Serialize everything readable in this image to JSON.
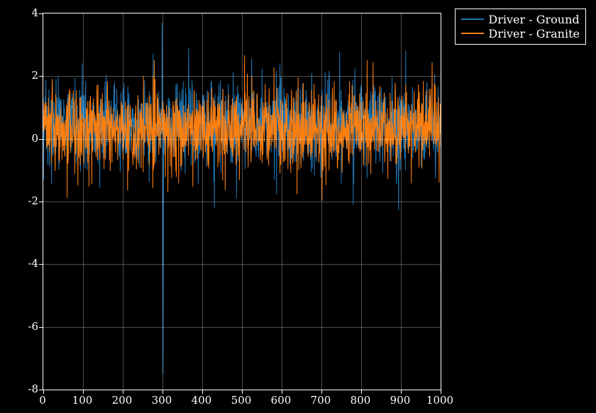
{
  "chart_data": {
    "type": "line",
    "title": "",
    "xlabel": "",
    "ylabel": "",
    "xlim": [
      0,
      1000
    ],
    "ylim": [
      -8,
      4
    ],
    "x_ticks": [
      0,
      100,
      200,
      300,
      400,
      500,
      600,
      700,
      800,
      900,
      1000
    ],
    "y_ticks": [
      -8,
      -6,
      -4,
      -2,
      0,
      2,
      4
    ],
    "grid": true,
    "legend_position": "outside-top-right",
    "series": [
      {
        "name": "Driver - Ground",
        "color": "#1f77b4",
        "baseline": 0.4,
        "noise_amp": 1.4,
        "spikes": [
          {
            "x": 300,
            "ymax": 3.7,
            "ymin": -7.5
          }
        ],
        "note": "dense noisy band approx 0.4±1.4 with large bipolar excursion near x≈300"
      },
      {
        "name": "Driver - Granite",
        "color": "#ff7f0e",
        "baseline": 0.3,
        "noise_amp": 1.3,
        "spikes": [],
        "note": "dense noisy band approx 0.3±1.3"
      }
    ]
  },
  "legend": {
    "items": [
      {
        "label": "Driver - Ground",
        "color": "#1f77b4"
      },
      {
        "label": "Driver - Granite",
        "color": "#ff7f0e"
      }
    ]
  },
  "axis": {
    "x_tick_labels": [
      "0",
      "100",
      "200",
      "300",
      "400",
      "500",
      "600",
      "700",
      "800",
      "900",
      "1000"
    ],
    "y_tick_labels": [
      "-8",
      "-6",
      "-4",
      "-2",
      "0",
      "2",
      "4"
    ]
  }
}
